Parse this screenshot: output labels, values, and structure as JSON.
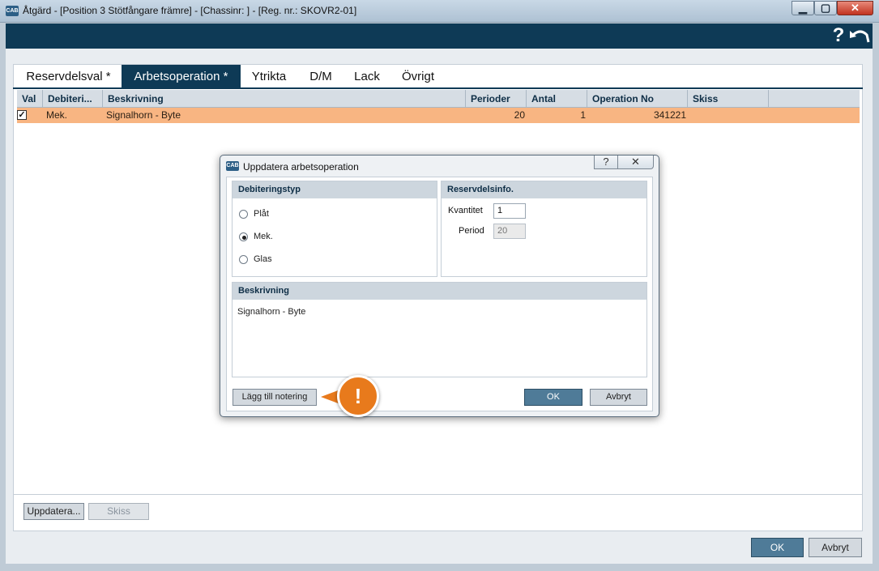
{
  "window": {
    "title": "Åtgärd - [Position 3 Stötfångare främre] - [Chassinr: ] - [Reg. nr.: SKOVR2-01]",
    "app_icon": "CAB"
  },
  "header": {
    "help": "?",
    "back_icon": "undo-arrow-icon"
  },
  "tabs": [
    {
      "label": "Reservdelsval *",
      "active": false
    },
    {
      "label": "Arbetsoperation *",
      "active": true
    },
    {
      "label": "Ytrikta",
      "active": false
    },
    {
      "label": "D/M",
      "active": false
    },
    {
      "label": "Lack",
      "active": false
    },
    {
      "label": "Övrigt",
      "active": false
    }
  ],
  "grid": {
    "columns": [
      "Val",
      "Debiteri...",
      "Beskrivning",
      "Perioder",
      "Antal",
      "Operation No",
      "Skiss"
    ],
    "rows": [
      {
        "checked": true,
        "debitering": "Mek.",
        "beskrivning": "Signalhorn - Byte",
        "perioder": "20",
        "antal": "1",
        "operation_no": "341221",
        "skiss": ""
      }
    ]
  },
  "bottom_buttons": {
    "uppdatera": "Uppdatera...",
    "skiss": "Skiss"
  },
  "footer": {
    "ok": "OK",
    "avbryt": "Avbryt"
  },
  "dialog": {
    "title": "Uppdatera arbetsoperation",
    "help": "?",
    "debiteringstyp": {
      "header": "Debiteringstyp",
      "options": [
        {
          "label": "Plåt",
          "checked": false
        },
        {
          "label": "Mek.",
          "checked": true
        },
        {
          "label": "Glas",
          "checked": false
        }
      ]
    },
    "reservdelsinfo": {
      "header": "Reservdelsinfo.",
      "kvantitet_label": "Kvantitet",
      "kvantitet_value": "1",
      "period_label": "Period",
      "period_value": "20"
    },
    "beskrivning": {
      "header": "Beskrivning",
      "text": "Signalhorn - Byte"
    },
    "add_note": "Lägg till notering",
    "ok": "OK",
    "avbryt": "Avbryt"
  },
  "tip": {
    "symbol": "!"
  },
  "colors": {
    "accent": "#0e3a56",
    "selected_row": "#f8b582",
    "tip": "#e87a1c"
  }
}
